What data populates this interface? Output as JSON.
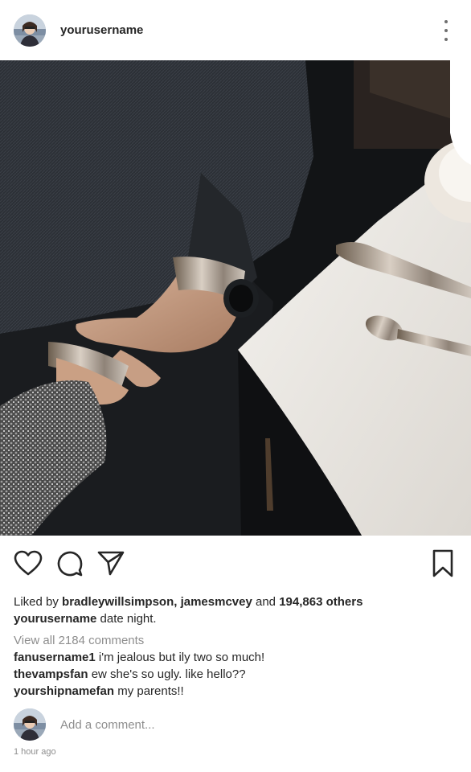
{
  "post": {
    "username": "yourusername"
  },
  "likes": {
    "prefix": "Liked by ",
    "users": "bradleywillsimpson, jamesmcvey",
    "conj": " and ",
    "count": "194,863 others"
  },
  "caption": {
    "username": "yourusername",
    "text": " date night."
  },
  "view_all_comments": "View all 2184 comments",
  "comments": [
    {
      "username": "fanusername1",
      "text": " i'm jealous but ily two so much!"
    },
    {
      "username": "thevampsfan",
      "text": " ew she's so ugly. like hello??"
    },
    {
      "username": "yourshipnamefan",
      "text": " my parents!!"
    }
  ],
  "add_comment": {
    "placeholder": "Add a comment..."
  },
  "timestamp": "1 hour ago",
  "icons": {
    "like": "heart-icon",
    "comment": "comment-bubble-icon",
    "share": "paper-plane-icon",
    "save": "bookmark-icon",
    "more": "more-vertical-icon"
  }
}
